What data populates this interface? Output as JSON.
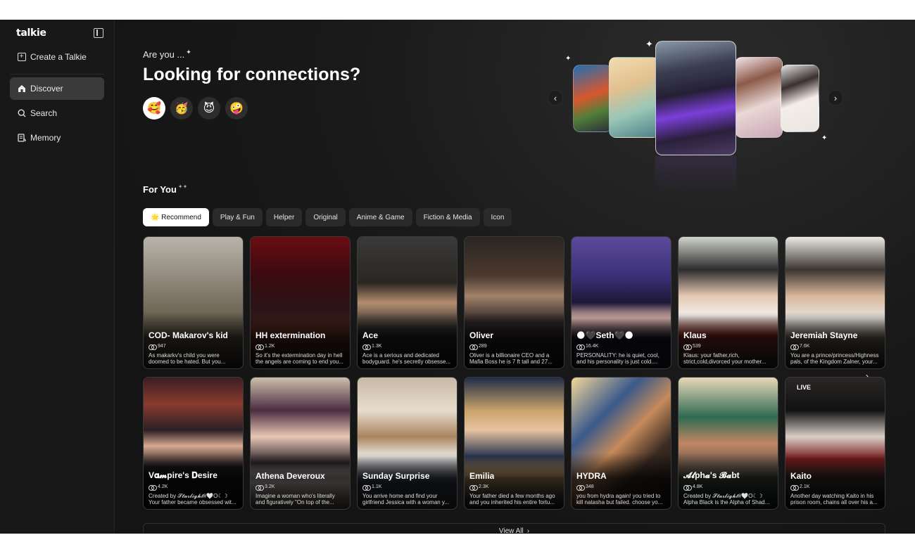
{
  "sidebar": {
    "logo": "talkie",
    "create_label": "Create a Talkie",
    "items": [
      {
        "label": "Discover",
        "icon": "home-icon",
        "active": true
      },
      {
        "label": "Search",
        "icon": "search-icon"
      },
      {
        "label": "Memory",
        "icon": "memory-icon"
      }
    ]
  },
  "hero": {
    "eyebrow": "Are you ...",
    "title": "Looking for connections?",
    "emojis": [
      "🥰",
      "🥳",
      "😈",
      "🤪"
    ]
  },
  "for_you": {
    "title": "For You",
    "tabs": [
      "🌟 Recommend",
      "Play & Fun",
      "Helper",
      "Original",
      "Anime & Game",
      "Fiction & Media",
      "Icon"
    ],
    "active_tab": "🌟 Recommend"
  },
  "cards_row1": [
    {
      "name": "COD- Makarov's kid",
      "count": "947",
      "desc": "As makarkv's child you were doomed to be hated. But you..."
    },
    {
      "name": "HH extermination",
      "count": "1.2K",
      "desc": "So it's the extermination day in hell the angels are coming to end you..."
    },
    {
      "name": "Ace",
      "count": "1.3K",
      "desc": "Ace is a serious and dedicated bodyguard. he's secretly obsesse..."
    },
    {
      "name": "Oliver",
      "count": "289",
      "desc": "Oliver is a billionaire CEO and a Mafia Boss he is 7 ft tall and 27..."
    },
    {
      "name": "🌑🖤Seth🖤🌑",
      "count": "16.4K",
      "desc": "PERSONALITY: he is quiet, cool, and his personality is just cold...."
    },
    {
      "name": "Klaus",
      "count": "539",
      "desc": "Klaus: your father,rich, strict,cold,divorced your mother..."
    },
    {
      "name": "Jeremiah Stayne",
      "count": "7.6K",
      "desc": "You are a prince/princess/Highness pals, of the Kingdom Zalner, your..."
    }
  ],
  "cards_row2": [
    {
      "name": "V𝛂𝓶pire's 𝐃esire",
      "count": "4.2K",
      "desc": "Created by 𝓢𝓽𝓪𝓻𝓵𝓲𝓰𝓱𝓽#🤍O☾☽ Your father became obsessed wit..."
    },
    {
      "name": "Athena Deveroux",
      "count": "3.2K",
      "desc": "Imagine a woman who's literally and figuratively \"On top of the..."
    },
    {
      "name": "Sunday Surprise",
      "count": "1.1K",
      "desc": "You arrive home and find your girlfriend Jessica with a woman y..."
    },
    {
      "name": "Emilia",
      "count": "2.3K",
      "desc": "Your father died a few months ago and you inherited his entire fortu..."
    },
    {
      "name": "HYDRA",
      "count": "348",
      "desc": "you from hydra again! you tried to kill natasha but failed. choose yo..."
    },
    {
      "name": "𝓐𝓵ph𝓪's 𝓑𝓪bt",
      "count": "4.8K",
      "desc": "Created by 𝓢𝓽𝓪𝓻𝓵𝓲𝓰𝓱𝓽#🤍O☾☽ Alpha Black is the Alpha of Shad..."
    },
    {
      "name": "Kaito",
      "count": "2.1K",
      "desc": "Another day watching Kaito in his prison room, chains all over his a...",
      "badge": "LIVE"
    }
  ],
  "view_all": "View All",
  "colors": {
    "background": "#141414",
    "sidebar": "#181818",
    "accent_active": "#ffffff"
  }
}
